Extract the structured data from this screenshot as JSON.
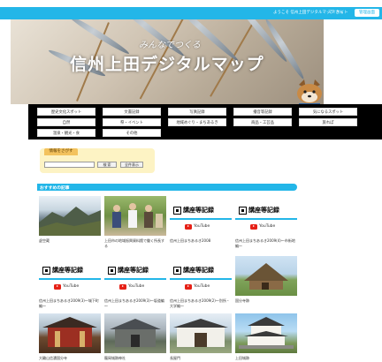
{
  "topbar": {
    "welcome": "ようこそ 信州上田デジタルマップ さん",
    "mysite": "マイサイト",
    "admin_label": "管理画面"
  },
  "hero": {
    "subtitle": "みんなでつくる",
    "title": "信州上田デジタルマップ"
  },
  "nav": {
    "items": [
      "歴史文化スポット",
      "文書記録",
      "写真記録",
      "播音等記録",
      "気になるスポット",
      "自然",
      "祭・イベント",
      "地域めぐり・まちあるき",
      "商品・工芸品",
      "旅れぽ",
      "温泉・観光・食",
      "その他"
    ]
  },
  "search": {
    "tab_label": "情報をさがす",
    "input_value": "",
    "search_button": "検 索",
    "advanced_button": "全件表示"
  },
  "section": {
    "title": "おすすめの記事"
  },
  "youtube": {
    "logo_text": "講座等記録",
    "yt_label": "YouTube"
  },
  "articles": [
    {
      "caption": "虚空蔵",
      "thumb": "mountain-landscape"
    },
    {
      "caption": "上田市の地域振興資料館で働く所長する",
      "thumb": "people-outdoor"
    },
    {
      "caption": "信州上田まちあるき2008",
      "thumb": "youtube"
    },
    {
      "caption": "信州上田まちあるき2009(4)～市街地編～",
      "thumb": "youtube"
    },
    {
      "caption": "信州上田まちあるき2009(3)～城下町編～",
      "thumb": "youtube"
    },
    {
      "caption": "信州上田まちあるき2009(3)～坂道編～",
      "thumb": "youtube"
    },
    {
      "caption": "信州上田まちあるき2009(2)～別所・大学編～",
      "thumb": "youtube"
    },
    {
      "caption": "国分寺跡",
      "thumb": "thatched-house"
    },
    {
      "caption": "大輪山信濃国分寺",
      "thumb": "temple-red"
    },
    {
      "caption": "龍岡城跡神社",
      "thumb": "shrine-grey"
    },
    {
      "caption": "長屋門",
      "thumb": "gate-white"
    },
    {
      "caption": "上田城跡",
      "thumb": "castle-white"
    }
  ]
}
